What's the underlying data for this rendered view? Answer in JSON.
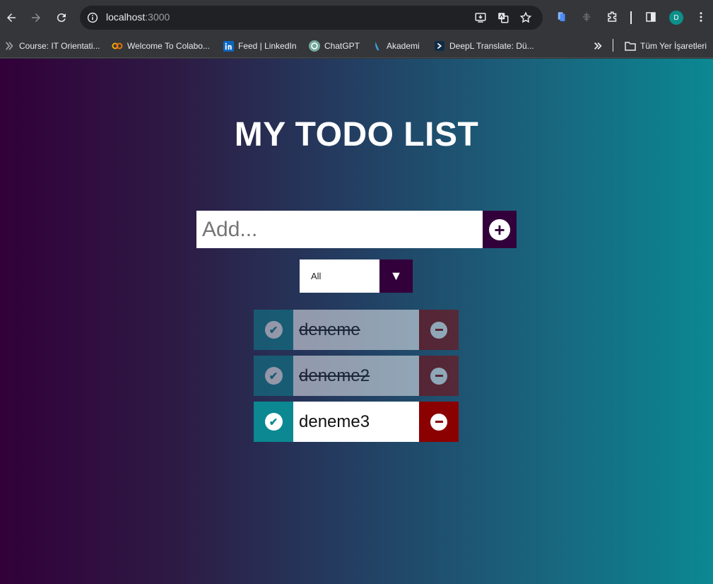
{
  "browser": {
    "url_host": "localhost",
    "url_port": ":3000",
    "profile_initial": "D",
    "bookmarks": [
      {
        "label": "Course: IT Orientati..."
      },
      {
        "label": "Welcome To Colabo..."
      },
      {
        "label": "Feed | LinkedIn"
      },
      {
        "label": "ChatGPT"
      },
      {
        "label": "Akademi"
      },
      {
        "label": "DeepL Translate: Dü..."
      }
    ],
    "all_bookmarks_label": "Tüm Yer İşaretleri"
  },
  "app": {
    "title": "MY TODO LIST",
    "input_placeholder": "Add...",
    "input_value": "",
    "add_button_symbol": "+",
    "filter": {
      "selected": "All",
      "arrow": "▼"
    },
    "todos": [
      {
        "text": "deneme",
        "completed": true
      },
      {
        "text": "deneme2",
        "completed": true
      },
      {
        "text": "deneme3",
        "completed": false
      }
    ]
  },
  "colors": {
    "gradient_start": "#32003a",
    "gradient_end": "#0b8892",
    "accent_dark": "#32003a",
    "check_teal": "#0b8892",
    "delete_red": "#8b0000"
  }
}
